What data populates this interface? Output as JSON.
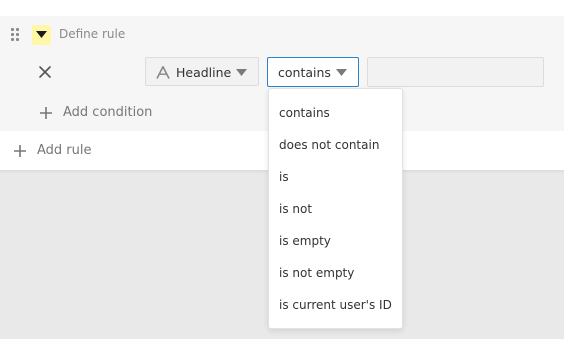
{
  "rule": {
    "title": "Define rule",
    "field_label": "Headline",
    "operator_label": "contains",
    "value": "",
    "value_placeholder": ""
  },
  "actions": {
    "add_condition_label": "Add condition",
    "add_rule_label": "Add rule"
  },
  "operator_options": [
    "contains",
    "does not contain",
    "is",
    "is not",
    "is empty",
    "is not empty",
    "is current user's ID"
  ],
  "colors": {
    "collapse_highlight": "#fff7a8",
    "focus_border": "#2f80c8"
  },
  "icons": {
    "drag": "drag-handle-icon",
    "collapse": "caret-down-icon",
    "remove": "close-icon",
    "field_type": "text-field-icon",
    "dropdown": "chevron-down-icon",
    "add": "plus-icon"
  }
}
